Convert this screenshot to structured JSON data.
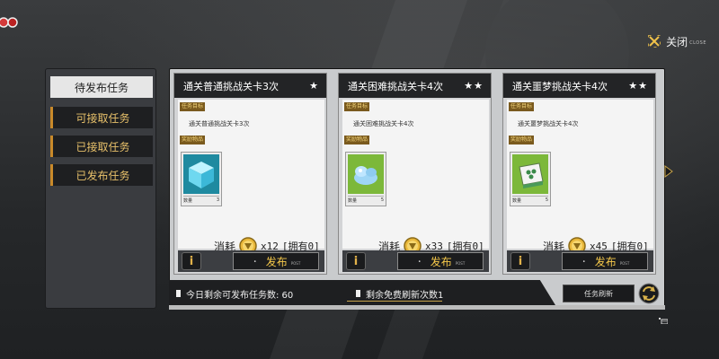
{
  "header": {
    "close_label": "关闭",
    "close_sub": "CLOSE",
    "close_icon": "close-x-icon"
  },
  "sidebar": {
    "tabs": [
      {
        "label": "待发布任务",
        "active": true
      },
      {
        "label": "可接取任务",
        "active": false
      },
      {
        "label": "已接取任务",
        "active": false
      },
      {
        "label": "已发布任务",
        "active": false
      }
    ]
  },
  "cards": [
    {
      "title": "通关普通挑战关卡3次",
      "stars": "★",
      "goal_tag": "任务目标",
      "goal": "通关普通挑战关卡3次",
      "reward_tag": "奖励物品",
      "reward_icon": "blue-cube-icon",
      "qty_label": "数量",
      "qty": "3",
      "cost_label": "消耗",
      "cost": "x12",
      "owned": "[拥有0]",
      "publish_label": "发布",
      "publish_sub": "POST",
      "info_label": "i"
    },
    {
      "title": "通关困难挑战关卡4次",
      "stars": "★★",
      "goal_tag": "任务目标",
      "goal": "通关困难挑战关卡4次",
      "reward_tag": "奖励物品",
      "reward_icon": "blue-slime-icon",
      "qty_label": "数量",
      "qty": "5",
      "cost_label": "消耗",
      "cost": "x33",
      "owned": "[拥有0]",
      "publish_label": "发布",
      "publish_sub": "POST",
      "info_label": "i"
    },
    {
      "title": "通关噩梦挑战关卡4次",
      "stars": "★★",
      "goal_tag": "任务目标",
      "goal": "通关噩梦挑战关卡4次",
      "reward_tag": "奖励物品",
      "reward_icon": "mahjong-tile-icon",
      "qty_label": "数量",
      "qty": "5",
      "cost_label": "消耗",
      "cost": "x45",
      "owned": "[拥有0]",
      "publish_label": "发布",
      "publish_sub": "POST",
      "info_label": "i"
    }
  ],
  "footer": {
    "daily_remaining": "今日剩余可发布任务数: 60",
    "free_refresh": "剩余免费刷新次数1",
    "refresh_label": "任务刷新"
  },
  "colors": {
    "accent_gold": "#f0c24a",
    "panel_dark": "#1e1f21",
    "tab_active": "#e6e6e6"
  }
}
